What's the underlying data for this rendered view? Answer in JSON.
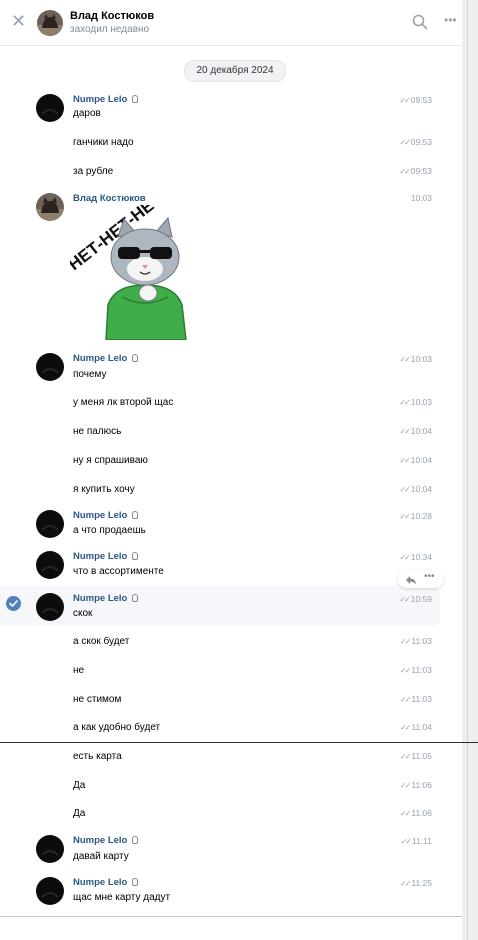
{
  "header": {
    "name": "Влад Костюков",
    "status": "заходил недавно",
    "close_icon": "close-icon",
    "search_icon": "search-icon",
    "more_icon": "more-icon"
  },
  "date_divider": "20 декабря 2024",
  "sticker_text": "НЕТ-НЕТ-НЕТ",
  "messages": [
    {
      "author": "Numpe Lelo",
      "text": "даров",
      "time": "09:53"
    },
    {
      "text": "ганчики надо",
      "time": "09:53"
    },
    {
      "text": "за рубле",
      "time": "09:53"
    },
    {
      "author": "Влад Костюков",
      "text": "",
      "time": "10:03",
      "sticker": true
    },
    {
      "author": "Numpe Lelo",
      "text": "почему",
      "time": "10:03"
    },
    {
      "text": "у меня лк второй щас",
      "time": "10:03"
    },
    {
      "text": "не палюсь",
      "time": "10:04"
    },
    {
      "text": "ну я спрашиваю",
      "time": "10:04"
    },
    {
      "text": "я купить хочу",
      "time": "10:04"
    },
    {
      "author": "Numpe Lelo",
      "text": "а что продаешь",
      "time": "10:28"
    },
    {
      "author": "Numpe Lelo",
      "text": "что в ассортименте",
      "time": "10:34"
    },
    {
      "author": "Numpe Lelo",
      "text": "скок",
      "time": "10:59",
      "selected": true
    },
    {
      "text": "а скок будет",
      "time": "11:03"
    },
    {
      "text": "не",
      "time": "11:03"
    },
    {
      "text": "не стимом",
      "time": "11:03"
    },
    {
      "text": "а как удобно будет",
      "time": "11:04"
    },
    {
      "text": "есть карта",
      "time": "11:05"
    },
    {
      "text": "Да",
      "time": "11:06"
    },
    {
      "text": "Да",
      "time": "11:06"
    },
    {
      "author": "Numpe Lelo",
      "text": "давай карту",
      "time": "11:11"
    },
    {
      "author": "Numpe Lelo",
      "text": "щас мне карту дадут",
      "time": "11:25"
    }
  ],
  "colors": {
    "link": "#2a5885",
    "meta": "#99a2ad",
    "accent": "#5181b8",
    "sticker_hoodie": "#3fae4a"
  }
}
